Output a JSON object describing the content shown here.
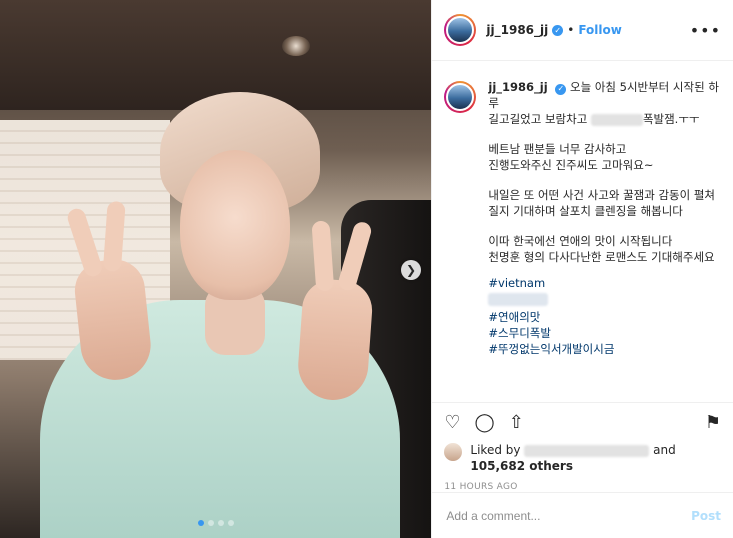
{
  "header": {
    "username": "jj_1986_jj",
    "separator": "•",
    "follow_label": "Follow",
    "more_label": "•••"
  },
  "caption": {
    "username": "jj_1986_jj",
    "line1": "오늘 아침 5시반부터 시작된 하루",
    "line2_prefix": "길고길었고 보람차고",
    "line2_suffix": "폭발잼.ㅜㅜ",
    "para2": "베트남 팬분들 너무 감사하고\n진행도와주신 진주씨도 고마워요~",
    "para3": "내일은 또 어떤 사건 사고와 꿀잼과 감동이 펼쳐질지 기대하며 살포치 클렌징을 해봅니다",
    "para4": "이따 한국에선 연애의 맛이 시작됩니다\n천명훈 형의 다사다난한 로맨스도 기대해주세요",
    "hashtags": [
      "#vietnam",
      "#연애의맛",
      "#스무디폭발",
      "#뚜껑없는익서개발이시금"
    ]
  },
  "likes": {
    "prefix": "Liked by",
    "and": "and",
    "count": "105,682 others"
  },
  "timestamp": "11 HOURS AGO",
  "comment": {
    "placeholder": "Add a comment...",
    "post_label": "Post"
  },
  "carousel": {
    "total": 4,
    "active_index": 0
  },
  "colors": {
    "accent": "#3897f0",
    "post_disabled": "#b2dffc",
    "hashtag": "#00376b"
  }
}
